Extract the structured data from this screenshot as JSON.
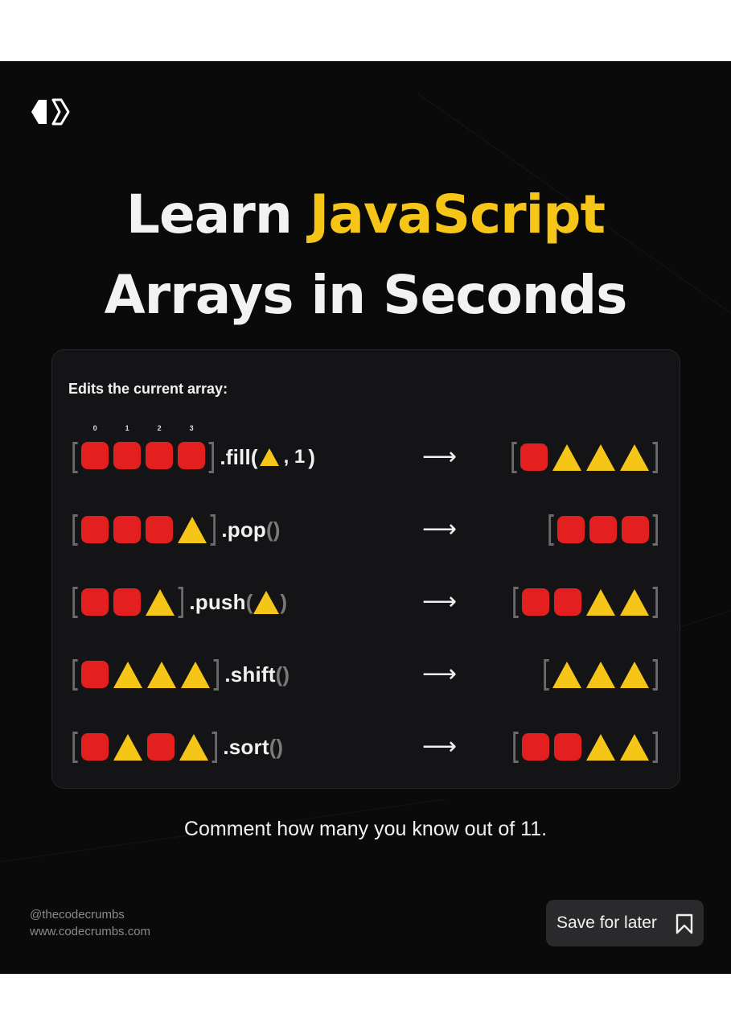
{
  "title": {
    "part1": "Learn ",
    "highlight": "JavaScript",
    "line2": "Arrays in Seconds"
  },
  "card": {
    "heading": "Edits the current array:",
    "index_labels": [
      "0",
      "1",
      "2",
      "3"
    ],
    "rows": [
      {
        "method": ".fill",
        "input": [
          "square",
          "square",
          "square",
          "square"
        ],
        "args_icon": "triangle",
        "args_text": ", 1",
        "output": [
          "square",
          "triangle",
          "triangle",
          "triangle"
        ]
      },
      {
        "method": ".pop",
        "input": [
          "square",
          "square",
          "square",
          "triangle"
        ],
        "output": [
          "square",
          "square",
          "square"
        ]
      },
      {
        "method": ".push",
        "input": [
          "square",
          "square",
          "triangle"
        ],
        "args_icon": "triangle",
        "output": [
          "square",
          "square",
          "triangle",
          "triangle"
        ]
      },
      {
        "method": ".shift",
        "input": [
          "square",
          "triangle",
          "triangle",
          "triangle"
        ],
        "output": [
          "triangle",
          "triangle",
          "triangle"
        ]
      },
      {
        "method": ".sort",
        "input": [
          "square",
          "triangle",
          "square",
          "triangle"
        ],
        "output": [
          "square",
          "square",
          "triangle",
          "triangle"
        ]
      }
    ],
    "arrow": "⟶",
    "paren_open": "(",
    "paren_close": ")",
    "bracket_open": "[",
    "bracket_close": "]"
  },
  "comment": "Comment how many you know out of 11.",
  "footer": {
    "handle": "@thecodecrumbs",
    "website": "www.codecrumbs.com",
    "save_label": "Save for later"
  },
  "colors": {
    "background": "#0a0a0a",
    "accent_yellow": "#f5c518",
    "square_red": "#e3201f",
    "card": "#141416"
  },
  "icons": {
    "logo": "codecrumbs-logo-icon",
    "save": "bookmark-icon"
  }
}
